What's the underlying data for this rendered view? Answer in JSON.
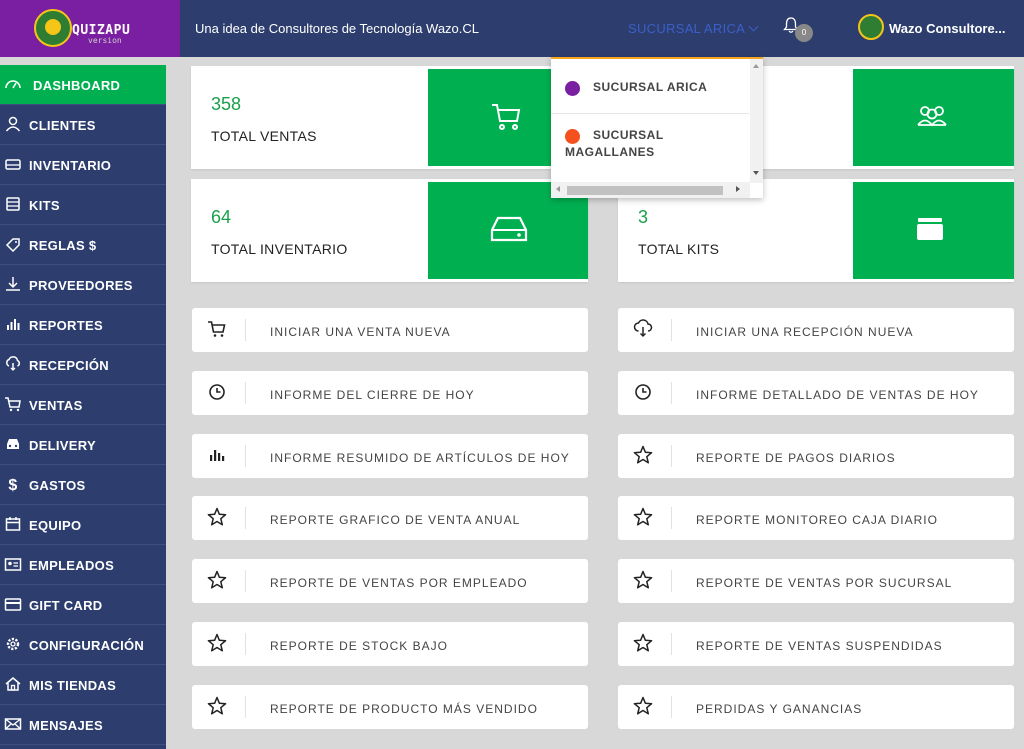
{
  "header": {
    "logo_text": "QUIZAPU",
    "logo_sub": "version",
    "logo_mark": "Wazo",
    "tagline": "Una idea de Consultores de Tecnología Wazo.CL",
    "branch_selected": "SUCURSAL ARICA",
    "notifications_count": "0",
    "user_name": "Wazo Consultore..."
  },
  "sidebar": {
    "items": [
      {
        "label": "DASHBOARD",
        "icon": "dashboard-icon"
      },
      {
        "label": "CLIENTES",
        "icon": "user-icon"
      },
      {
        "label": "INVENTARIO",
        "icon": "inventory-icon"
      },
      {
        "label": "KITS",
        "icon": "kits-icon"
      },
      {
        "label": "REGLAS $",
        "icon": "tag-icon"
      },
      {
        "label": "PROVEEDORES",
        "icon": "download-icon"
      },
      {
        "label": "REPORTES",
        "icon": "bar-chart-icon"
      },
      {
        "label": "RECEPCIÓN",
        "icon": "cloud-download-icon"
      },
      {
        "label": "VENTAS",
        "icon": "cart-icon"
      },
      {
        "label": "DELIVERY",
        "icon": "car-icon"
      },
      {
        "label": "GASTOS",
        "icon": "dollar-icon"
      },
      {
        "label": "EQUIPO",
        "icon": "calendar-icon"
      },
      {
        "label": "EMPLEADOS",
        "icon": "id-card-icon"
      },
      {
        "label": "GIFT CARD",
        "icon": "credit-card-icon"
      },
      {
        "label": "CONFIGURACIÓN",
        "icon": "gear-icon"
      },
      {
        "label": "MIS TIENDAS",
        "icon": "home-icon"
      },
      {
        "label": "MENSAJES",
        "icon": "mail-icon"
      }
    ]
  },
  "stats": [
    {
      "value": "358",
      "label": "TOTAL VENTAS",
      "icon": "cart-icon"
    },
    {
      "value": "",
      "label": "",
      "icon": "users-icon"
    },
    {
      "value": "64",
      "label": "TOTAL INVENTARIO",
      "icon": "hard-drive-icon"
    },
    {
      "value": "3",
      "label": "TOTAL KITS",
      "icon": "folder-icon"
    }
  ],
  "actions": [
    {
      "label": "INICIAR UNA VENTA NUEVA",
      "icon": "cart-icon"
    },
    {
      "label": "INICIAR UNA RECEPCIÓN NUEVA",
      "icon": "cloud-download-icon"
    },
    {
      "label": "INFORME DEL CIERRE DE HOY",
      "icon": "clock-icon"
    },
    {
      "label": "INFORME DETALLADO DE VENTAS DE HOY",
      "icon": "clock-icon"
    },
    {
      "label": "INFORME RESUMIDO DE ARTÍCULOS DE HOY",
      "icon": "bar-chart-icon"
    },
    {
      "label": "REPORTE DE PAGOS DIARIOS",
      "icon": "star-icon"
    },
    {
      "label": "REPORTE GRAFICO DE VENTA ANUAL",
      "icon": "star-icon"
    },
    {
      "label": "REPORTE MONITOREO CAJA DIARIO",
      "icon": "star-icon"
    },
    {
      "label": "REPORTE DE VENTAS POR EMPLEADO",
      "icon": "star-icon"
    },
    {
      "label": "REPORTE DE VENTAS POR SUCURSAL",
      "icon": "star-icon"
    },
    {
      "label": "REPORTE DE STOCK BAJO",
      "icon": "star-icon"
    },
    {
      "label": "REPORTE DE VENTAS SUSPENDIDAS",
      "icon": "star-icon"
    },
    {
      "label": "REPORTE DE PRODUCTO MÁS VENDIDO",
      "icon": "star-icon"
    },
    {
      "label": "PERDIDAS Y GANANCIAS",
      "icon": "star-icon"
    }
  ],
  "branch_dropdown": {
    "options": [
      {
        "label": "SUCURSAL ARICA",
        "color": "#7b1fa2"
      },
      {
        "label": "SUCURSAL MAGALLANES",
        "color": "#f4511e"
      }
    ]
  },
  "colors": {
    "accent": "#00b050",
    "nav": "#2d3e6e",
    "brand": "#7b1fa2"
  }
}
